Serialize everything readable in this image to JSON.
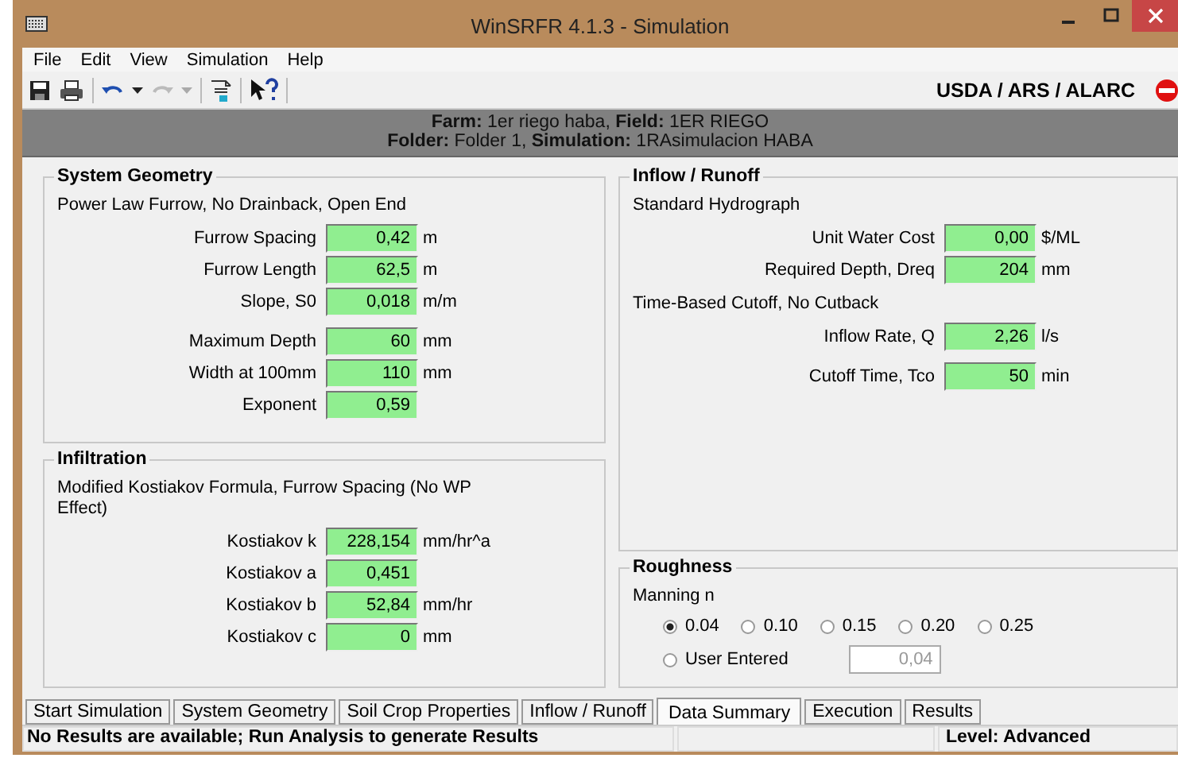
{
  "window": {
    "title": "WinSRFR 4.1.3 - Simulation"
  },
  "menu": [
    "File",
    "Edit",
    "View",
    "Simulation",
    "Help"
  ],
  "toolbar": {
    "org": "USDA / ARS / ALARC"
  },
  "header": {
    "lines": [
      "**Farm:** 1er riego haba, **Field:** 1ER RIEGO",
      "**Folder:** Folder 1, **Simulation:** 1RAsimulacion HABA"
    ]
  },
  "left_panels": [
    {
      "title": "System Geometry",
      "items": [
        {
          "kind": "note",
          "text": "Power Law Furrow, No Drainback, Open End"
        },
        {
          "kind": "fields",
          "fields": [
            {
              "label": "Furrow Spacing",
              "value": "0,42",
              "unit": "m"
            },
            {
              "label": "Furrow Length",
              "value": "62,5",
              "unit": "m"
            },
            {
              "label": "Slope, S0",
              "value": "0,018",
              "unit": "m/m"
            }
          ]
        },
        {
          "kind": "fields",
          "fields": [
            {
              "label": "Maximum Depth",
              "value": "60",
              "unit": "mm"
            },
            {
              "label": "Width at 100mm",
              "value": "110",
              "unit": "mm"
            },
            {
              "label": "Exponent",
              "value": "0,59"
            }
          ]
        }
      ]
    },
    {
      "title": "Infiltration",
      "items": [
        {
          "kind": "note",
          "text": "Modified Kostiakov Formula, Furrow Spacing (No WP Effect)"
        },
        {
          "kind": "fields",
          "fields": [
            {
              "label": "Kostiakov k",
              "value": "228,154",
              "unit": "mm/hr^a"
            },
            {
              "label": "Kostiakov a",
              "value": "0,451"
            },
            {
              "label": "Kostiakov b",
              "value": "52,84",
              "unit": "mm/hr"
            },
            {
              "label": "Kostiakov c",
              "value": "0",
              "unit": "mm"
            }
          ]
        }
      ]
    }
  ],
  "right_panels": [
    {
      "title": "Inflow / Runoff",
      "items": [
        {
          "kind": "note",
          "text": "Standard Hydrograph"
        },
        {
          "kind": "fields",
          "fields": [
            {
              "label": "Unit Water Cost",
              "value": "0,00",
              "unit": "$/ML"
            },
            {
              "label": "Required Depth, Dreq",
              "value": "204",
              "unit": "mm"
            }
          ]
        },
        {
          "kind": "note",
          "text": "Time-Based Cutoff, No Cutback"
        },
        {
          "kind": "fields",
          "fields": [
            {
              "label": "Inflow Rate, Q",
              "value": "2,26",
              "unit": "l/s"
            }
          ]
        },
        {
          "kind": "fields",
          "fields": [
            {
              "label": "Cutoff Time, Tco",
              "value": "50",
              "unit": "min"
            }
          ]
        }
      ]
    }
  ],
  "roughness": {
    "title": "Roughness",
    "label": "Manning n",
    "options": [
      {
        "label": "0.04",
        "selected": true
      },
      {
        "label": "0.10",
        "selected": false
      },
      {
        "label": "0.15",
        "selected": false
      },
      {
        "label": "0.20",
        "selected": false
      },
      {
        "label": "0.25",
        "selected": false
      }
    ],
    "user_entered": {
      "label": "User Entered",
      "selected": false,
      "value": "0,04",
      "disabled": true
    }
  },
  "tabs": [
    {
      "label": "Start Simulation",
      "selected": false
    },
    {
      "label": "System Geometry",
      "selected": false
    },
    {
      "label": "Soil Crop Properties",
      "selected": false
    },
    {
      "label": "Inflow / Runoff",
      "selected": false
    },
    {
      "label": "Data Summary",
      "selected": true
    },
    {
      "label": "Execution",
      "selected": false
    },
    {
      "label": "Results",
      "selected": false
    }
  ],
  "status_bar": {
    "message": "No Results are available; Run Analysis to generate Results",
    "level": "Level: Advanced"
  }
}
